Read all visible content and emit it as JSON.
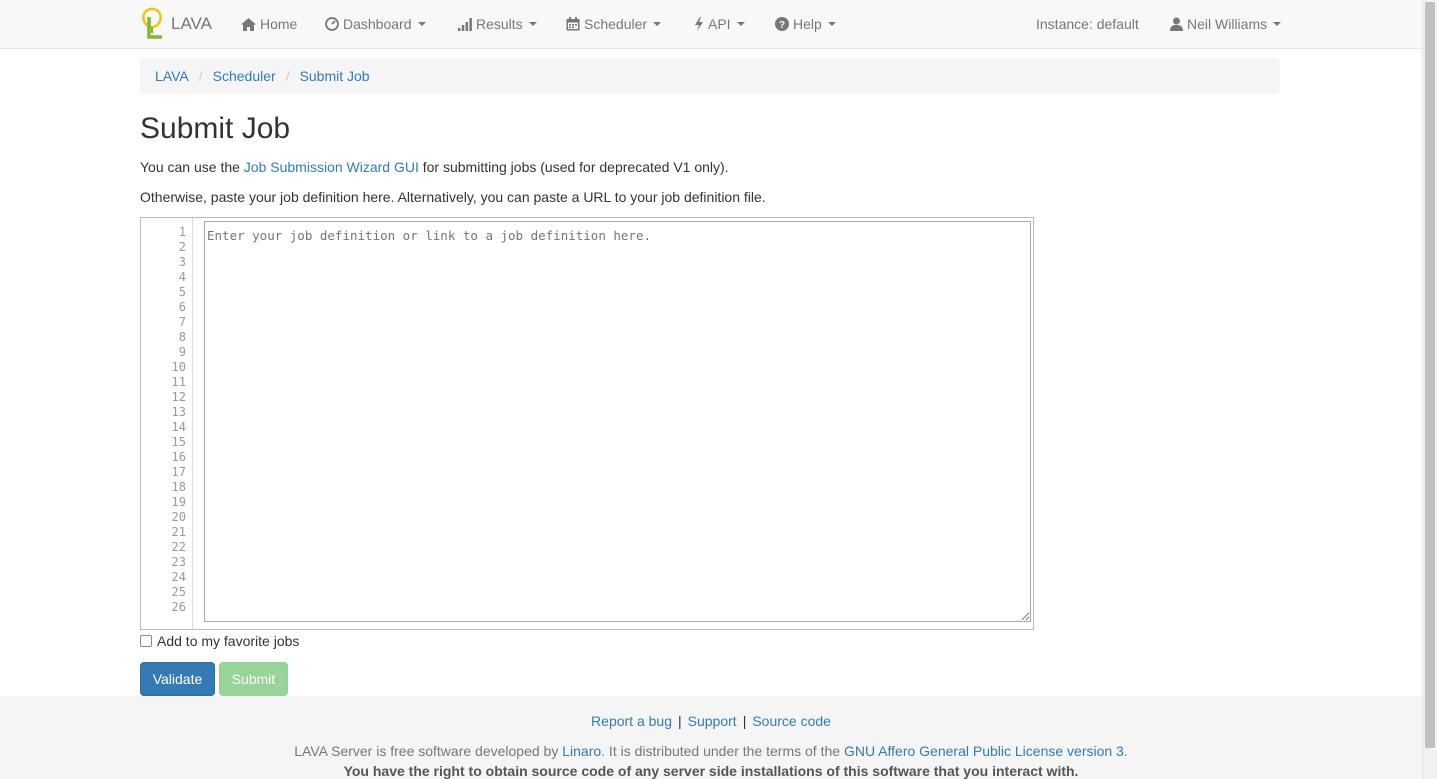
{
  "nav": {
    "brand": "LAVA",
    "items": [
      {
        "label": "Home",
        "icon": "home-icon"
      },
      {
        "label": "Dashboard",
        "icon": "dashboard-icon"
      },
      {
        "label": "Results",
        "icon": "signal-icon"
      },
      {
        "label": "Scheduler",
        "icon": "calendar-icon"
      },
      {
        "label": "API",
        "icon": "bolt-icon"
      },
      {
        "label": "Help",
        "icon": "question-icon"
      }
    ],
    "instance": "Instance: default",
    "user": "Neil Williams"
  },
  "breadcrumb": [
    "LAVA",
    "Scheduler",
    "Submit Job"
  ],
  "page": {
    "title": "Submit Job",
    "intro_prefix": "You can use the ",
    "intro_link": "Job Submission Wizard GUI",
    "intro_suffix": " for submitting jobs (used for deprecated V1 only).",
    "instructions": "Otherwise, paste your job definition here. Alternatively, you can paste a URL to your job definition file."
  },
  "editor": {
    "placeholder": "Enter your job definition or link to a job definition here.",
    "line_numbers": [
      "1",
      "2",
      "3",
      "4",
      "5",
      "6",
      "7",
      "8",
      "9",
      "10",
      "11",
      "12",
      "13",
      "14",
      "15",
      "16",
      "17",
      "18",
      "19",
      "20",
      "21",
      "22",
      "23",
      "24",
      "25",
      "26"
    ]
  },
  "favorite_label": "Add to my favorite jobs",
  "buttons": {
    "validate": "Validate",
    "submit": "Submit"
  },
  "footer": {
    "links": [
      "Report a bug",
      "Support",
      "Source code"
    ],
    "license_prefix": "LAVA Server is free software developed by ",
    "license_org": "Linaro",
    "license_mid": ". It is distributed under the terms of the ",
    "license_link": "GNU Affero General Public License version 3",
    "license_suffix": ".",
    "rights": "You have the right to obtain source code of any server side installations of this software that you interact with."
  },
  "colors": {
    "link": "#337ab7",
    "primary": "#337ab7",
    "success_disabled": "#93d194"
  }
}
